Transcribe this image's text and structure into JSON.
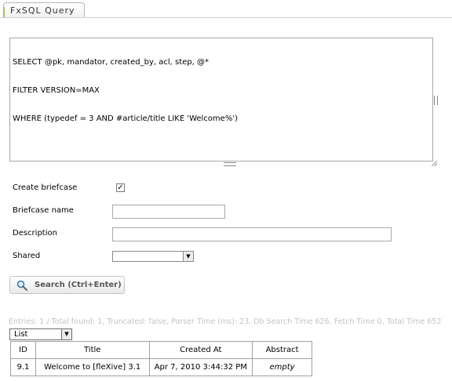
{
  "tab": {
    "label": "FxSQL Query"
  },
  "query": {
    "lines": [
      "SELECT @pk, mandator, created_by, acl, step, @*",
      "FILTER VERSION=MAX",
      "WHERE (typedef = 3 AND #article/title LIKE 'Welcome%')"
    ]
  },
  "form": {
    "create_briefcase_label": "Create briefcase",
    "create_briefcase_checked": true,
    "create_briefcase_mark": "✓",
    "briefcase_name_label": "Briefcase name",
    "briefcase_name_value": "",
    "description_label": "Description",
    "description_value": "",
    "shared_label": "Shared",
    "shared_value": ""
  },
  "search_button": {
    "label": "Search (Ctrl+Enter)",
    "icon": "magnifier-icon"
  },
  "stats": "Entries: 1 / Total found: 1, Truncated: false, Parser Time (ms): 23, Db Search Time 626, Fetch Time 0, Total Time 652",
  "view_select": {
    "value": "List"
  },
  "results": {
    "columns": [
      "ID",
      "Title",
      "Created At",
      "Abstract"
    ],
    "rows": [
      [
        "9.1",
        "Welcome to [fleXive] 3.1",
        "Apr 7, 2010 3:44:32 PM",
        "empty"
      ]
    ]
  }
}
